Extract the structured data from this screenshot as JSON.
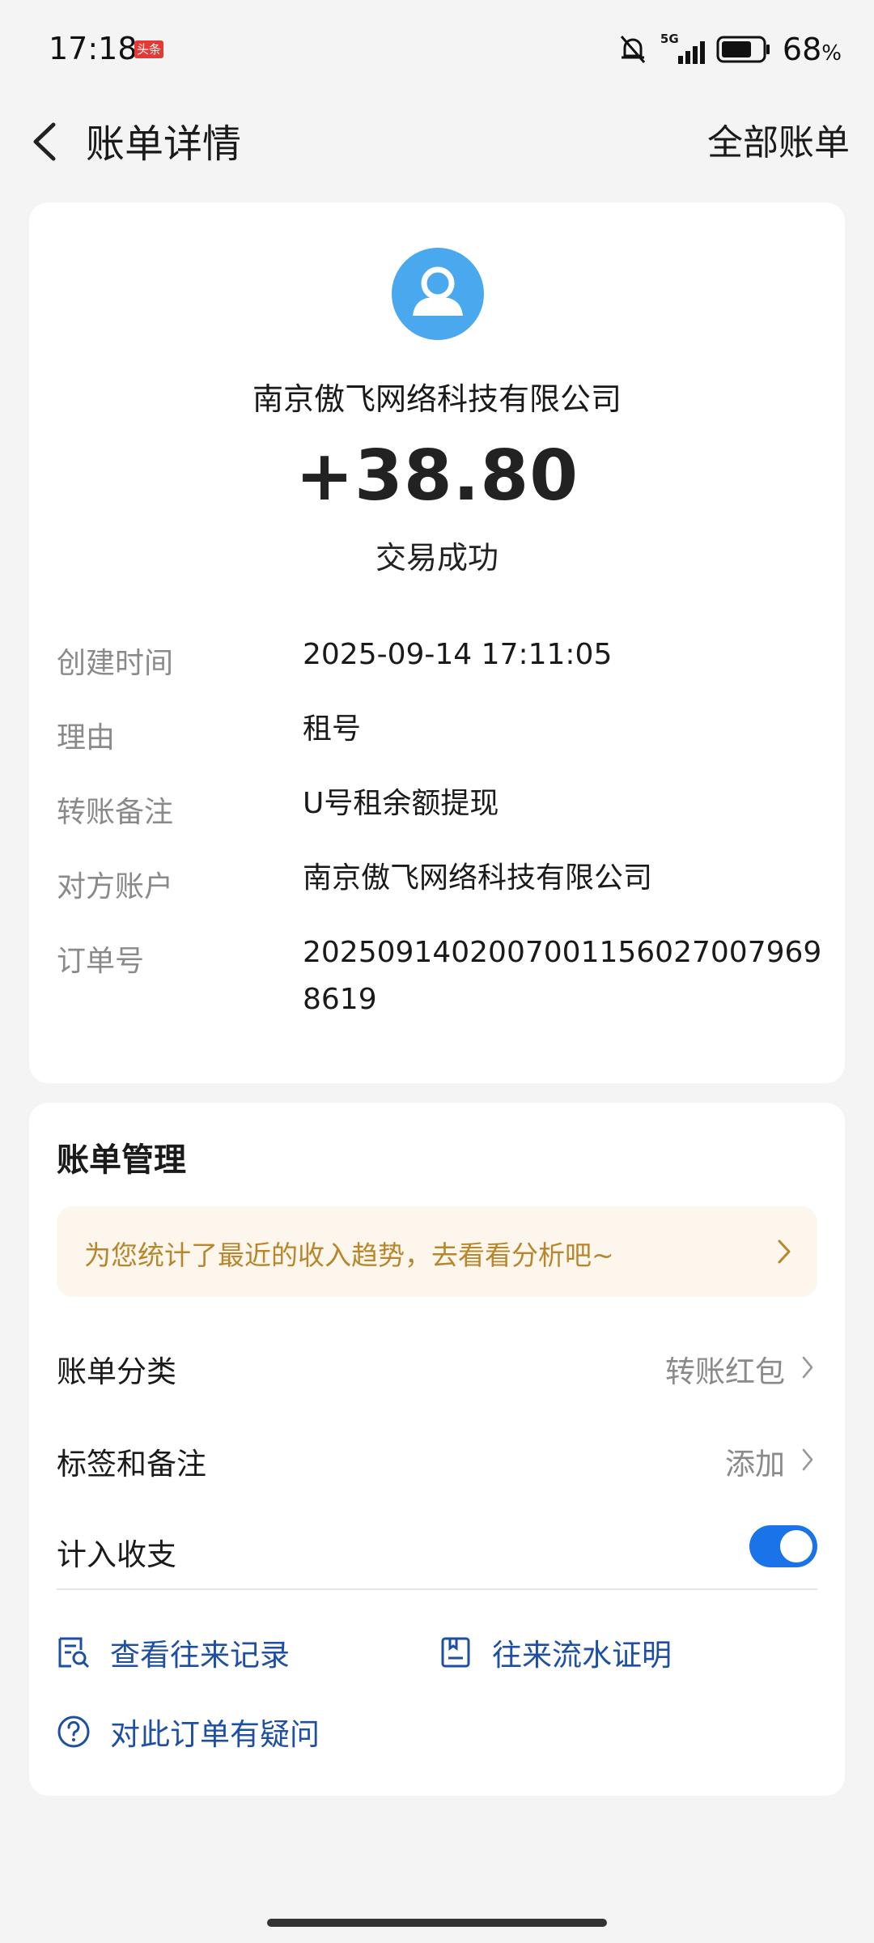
{
  "status_bar": {
    "time": "17:18",
    "badge": "头条",
    "network": "5G",
    "battery": "68",
    "battery_unit": "%",
    "icons": [
      "bell-mute-icon",
      "signal-icon",
      "battery-icon"
    ]
  },
  "header": {
    "title": "账单详情",
    "right_action": "全部账单"
  },
  "transaction": {
    "merchant": "南京傲飞网络科技有限公司",
    "amount": "+38.80",
    "status": "交易成功",
    "details": [
      {
        "label": "创建时间",
        "value": "2025-09-14 17:11:05"
      },
      {
        "label": "理由",
        "value": "租号"
      },
      {
        "label": "转账备注",
        "value": "U号租余额提现"
      },
      {
        "label": "对方账户",
        "value": "南京傲飞网络科技有限公司"
      },
      {
        "label": "订单号",
        "value": "20250914020070011560270079698619"
      }
    ]
  },
  "manage": {
    "title": "账单管理",
    "promo": "为您统计了最近的收入趋势，去看看分析吧~",
    "category_label": "账单分类",
    "category_value": "转账红包",
    "tags_label": "标签和备注",
    "tags_value": "添加",
    "count_label": "计入收支",
    "count_enabled": true,
    "link_records": "查看往来记录",
    "link_proof": "往来流水证明",
    "link_question": "对此订单有疑问"
  },
  "colors": {
    "accent": "#1a73e8",
    "link": "#1e4fa3",
    "promo_text": "#b8862c",
    "promo_bg": "#fdf6ec",
    "avatar": "#4aa8ef"
  }
}
